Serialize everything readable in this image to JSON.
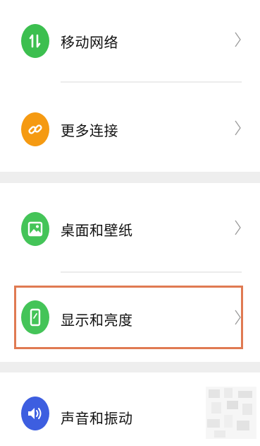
{
  "settings": {
    "items": [
      {
        "label": "移动网络",
        "icon": "mobile-data-icon",
        "icon_color": "#3cbf4f"
      },
      {
        "label": "更多连接",
        "icon": "link-icon",
        "icon_color": "#f59a12"
      },
      {
        "label": "桌面和壁纸",
        "icon": "wallpaper-icon",
        "icon_color": "#44c458"
      },
      {
        "label": "显示和亮度",
        "icon": "display-phone-icon",
        "icon_color": "#44c458",
        "highlighted": true
      },
      {
        "label": "声音和振动",
        "icon": "speaker-icon",
        "icon_color": "#3d5ee0"
      }
    ],
    "chevron_icon": "chevron-right-icon",
    "highlight_color": "#e07a52"
  }
}
